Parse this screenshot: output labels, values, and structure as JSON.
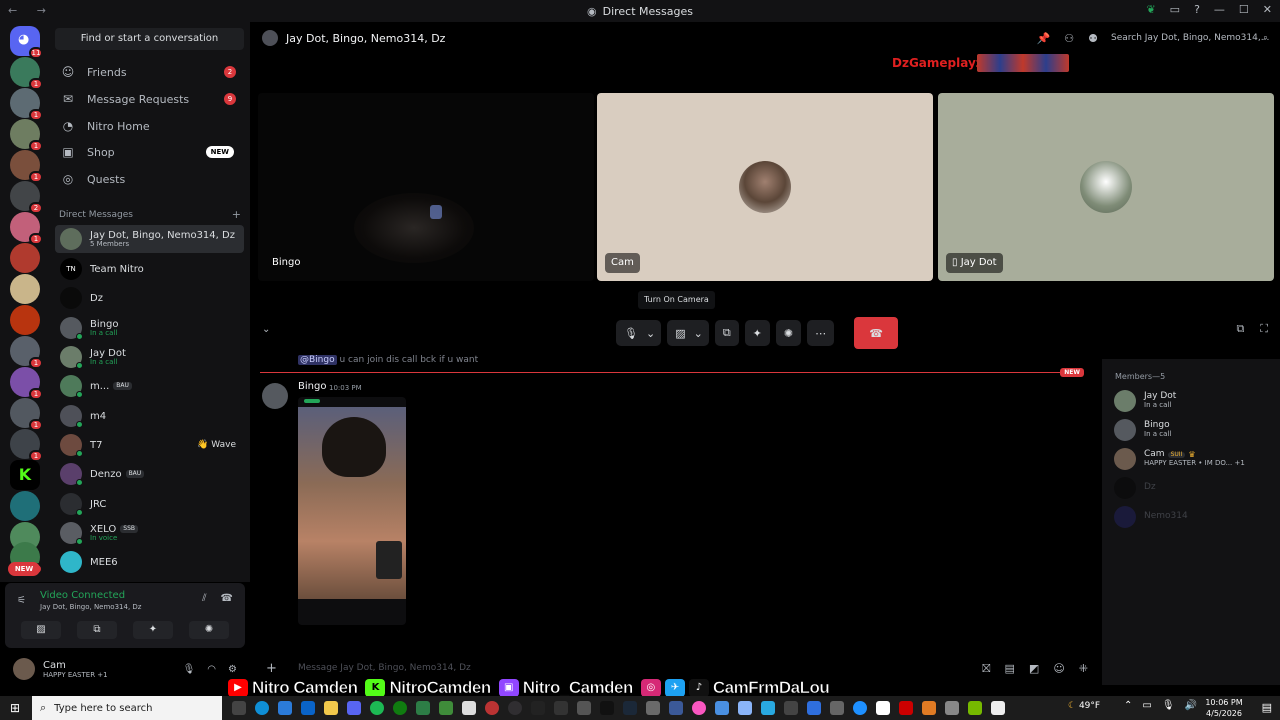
{
  "window": {
    "title": "Direct Messages",
    "nav": "← →"
  },
  "servers": {
    "badges": [
      "11",
      "1",
      "1",
      "1",
      "1",
      "2",
      "1",
      "1",
      "1",
      "1",
      "1",
      "1"
    ],
    "new_label": "NEW"
  },
  "sidebar": {
    "search_label": "Find or start a conversation",
    "nav_items": [
      {
        "label": "Friends",
        "icon": "friends-icon",
        "count": "2"
      },
      {
        "label": "Message Requests",
        "icon": "mail-icon",
        "count": "9"
      },
      {
        "label": "Nitro Home",
        "icon": "nitro-icon"
      },
      {
        "label": "Shop",
        "icon": "shop-icon",
        "tag": "NEW"
      },
      {
        "label": "Quests",
        "icon": "quests-icon"
      }
    ],
    "dm_header": "Direct Messages",
    "dm_add": "+",
    "dms": [
      {
        "name": "Jay Dot, Bingo, Nemo314, Dz",
        "sub": "5 Members"
      },
      {
        "name": "Team Nitro",
        "sub": ""
      },
      {
        "name": "Dz",
        "sub": ""
      },
      {
        "name": "Bingo",
        "sub": "In a call"
      },
      {
        "name": "Jay Dot",
        "sub": "In a call"
      },
      {
        "name": "m...",
        "sub": "",
        "tag": "BAU"
      },
      {
        "name": "m4",
        "sub": ""
      },
      {
        "name": "T7",
        "sub": "",
        "action": "Wave"
      },
      {
        "name": "Denzo",
        "sub": "",
        "tag": "BAU"
      },
      {
        "name": "JRC",
        "sub": ""
      },
      {
        "name": "XELO",
        "sub": "In voice",
        "tag": "SSB"
      },
      {
        "name": "MEE6",
        "sub": ""
      }
    ]
  },
  "voice": {
    "status": "Video Connected",
    "channel": "Jay Dot, Bingo, Nemo314, Dz"
  },
  "user": {
    "name": "Cam",
    "status": "HAPPY EASTER",
    "extra": "+1"
  },
  "chat": {
    "title": "Jay Dot, Bingo, Nemo314, Dz",
    "search_placeholder": "Search Jay Dot, Bingo, Nemo314,...",
    "composer_placeholder": "Message Jay Dot, Bingo, Nemo314, Dz"
  },
  "call": {
    "overlay_name": "DzGameplayz",
    "tiles": [
      {
        "label": "Bingo"
      },
      {
        "label": "Cam"
      },
      {
        "label": "Jay Dot"
      }
    ],
    "tooltip": "Turn On Camera"
  },
  "messages": {
    "mention": "@Bingo",
    "mention_rest": " u can join dis call bck if u want",
    "new_label": "NEW",
    "author": "Bingo",
    "time": "10:03 PM"
  },
  "members": {
    "header": "Members—5",
    "list": [
      {
        "name": "Jay Dot",
        "sub": "In a call"
      },
      {
        "name": "Bingo",
        "sub": "In a call"
      },
      {
        "name": "Cam",
        "sub": "HAPPY EASTER • IM DO...",
        "tag": "SUII",
        "extra": "+1"
      },
      {
        "name": "Dz",
        "sub": ""
      },
      {
        "name": "Nemo314",
        "sub": ""
      }
    ]
  },
  "banner": {
    "youtube": "Nitro Camden",
    "kick": "NitroCamden",
    "twitch": "Nitro_Camden",
    "socials": "CamFrmDaLou"
  },
  "taskbar": {
    "search_placeholder": "Type here to search",
    "weather": "49°F",
    "time": "10:06 PM",
    "date": "4/5/2026"
  },
  "colors": {
    "accent_red": "#da373c",
    "online_green": "#23a559",
    "overlay_red": "#e02020"
  }
}
